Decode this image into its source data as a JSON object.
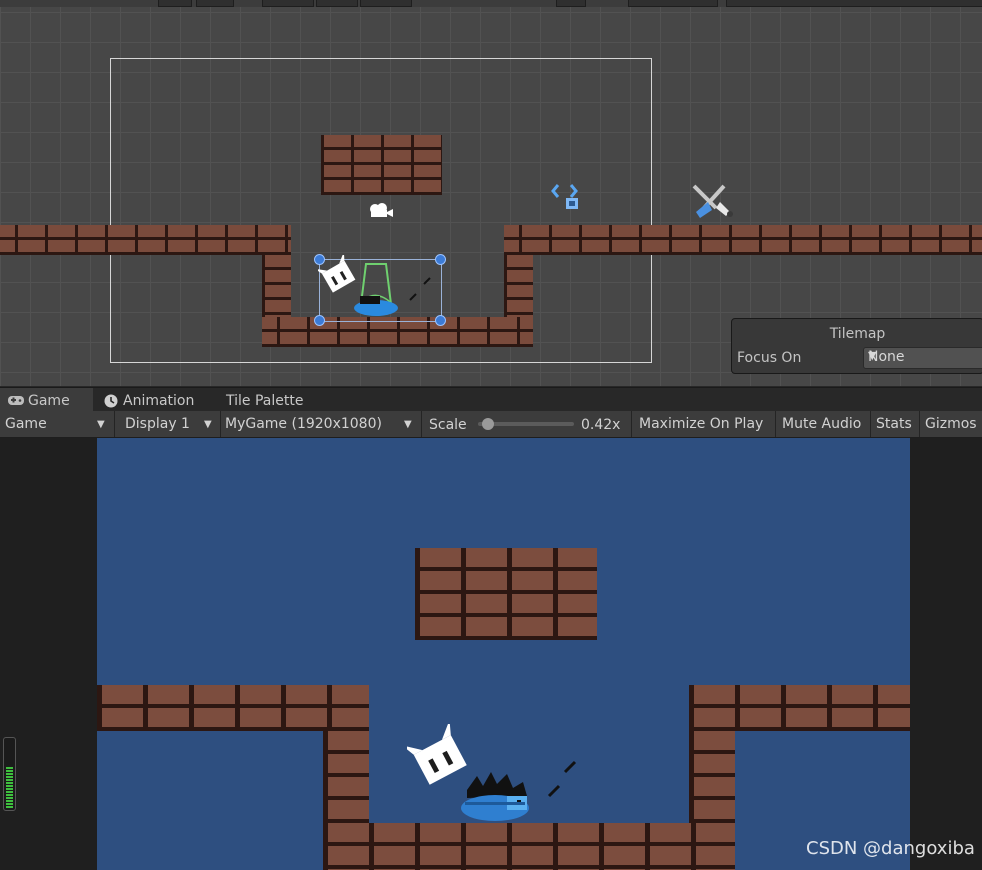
{
  "tabs": [
    {
      "label": "Game",
      "icon": "gamepad-icon",
      "active": true
    },
    {
      "label": "Animation",
      "icon": "clock-icon",
      "active": false
    },
    {
      "label": "Tile Palette",
      "icon": "",
      "active": false
    }
  ],
  "game_toolbar": {
    "view_select": "Game",
    "display_select": "Display 1",
    "resolution_select": "MyGame (1920x1080)",
    "scale_label": "Scale",
    "scale_value": "0.42x",
    "scale_level": 0.05,
    "maximize_on_play": "Maximize On Play",
    "mute_audio": "Mute Audio",
    "stats": "Stats",
    "gizmos": "Gizmos"
  },
  "tilemap_overlay": {
    "title": "Tilemap",
    "focus_label": "Focus On",
    "focus_value": "None"
  },
  "scene_icons": [
    "camera-gizmo-icon",
    "grid-gizmo-icon",
    "tool-gizmo-icon"
  ],
  "colors": {
    "scene_bg": "#474747",
    "game_bg": "#2e4f80",
    "brick": "#7a4b3c",
    "selection_handle": "#3c7bd6"
  },
  "audio_level": 0.6,
  "watermark": "CSDN @dangoxiba"
}
